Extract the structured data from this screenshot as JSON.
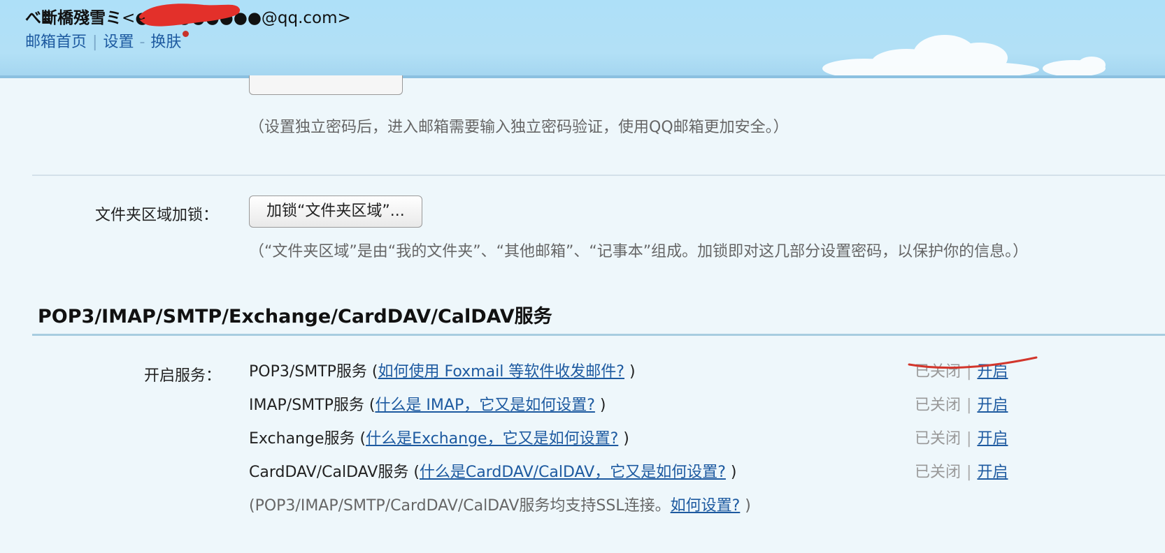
{
  "header": {
    "user_name": "べ斷橋殘雪ミ",
    "email": "<●●●●●●●●●@qq.com>",
    "nav": {
      "home": "邮箱首页",
      "divider": "|",
      "settings": "设置",
      "dash": "-",
      "skin": "换肤"
    }
  },
  "password": {
    "note": "（设置独立密码后，进入邮箱需要输入独立密码验证，使用QQ邮箱更加安全。）"
  },
  "folder_lock": {
    "label": "文件夹区域加锁：",
    "button": "加锁“文件夹区域”...",
    "note": "（“文件夹区域”是由“我的文件夹”、“其他邮箱”、“记事本”组成。加锁即对这几部分设置密码，以保护你的信息。）"
  },
  "services": {
    "title": "POP3/IMAP/SMTP/Exchange/CardDAV/CalDAV服务",
    "label": "开启服务：",
    "items": [
      {
        "name": "POP3/SMTP服务 (",
        "help": "如何使用 Foxmail 等软件收发邮件?",
        "close_paren": " )",
        "status": "已关闭",
        "sep": "|",
        "action": "开启"
      },
      {
        "name": "IMAP/SMTP服务 (",
        "help": "什么是 IMAP，它又是如何设置?",
        "close_paren": " )",
        "status": "已关闭",
        "sep": "|",
        "action": "开启"
      },
      {
        "name": "Exchange服务 (",
        "help": "什么是Exchange，它又是如何设置?",
        "close_paren": " )",
        "status": "已关闭",
        "sep": "|",
        "action": "开启"
      },
      {
        "name": "CardDAV/CalDAV服务 (",
        "help": "什么是CardDAV/CalDAV，它又是如何设置?",
        "close_paren": " )",
        "status": "已关闭",
        "sep": "|",
        "action": "开启"
      }
    ],
    "footnote": {
      "text": "(POP3/IMAP/SMTP/CardDAV/CalDAV服务均支持SSL连接。",
      "link": "如何设置?",
      "close": " )"
    }
  },
  "colors": {
    "link": "#1d5aa0",
    "header_bg": "#aee0f8",
    "annotation_red": "#d2362c"
  }
}
